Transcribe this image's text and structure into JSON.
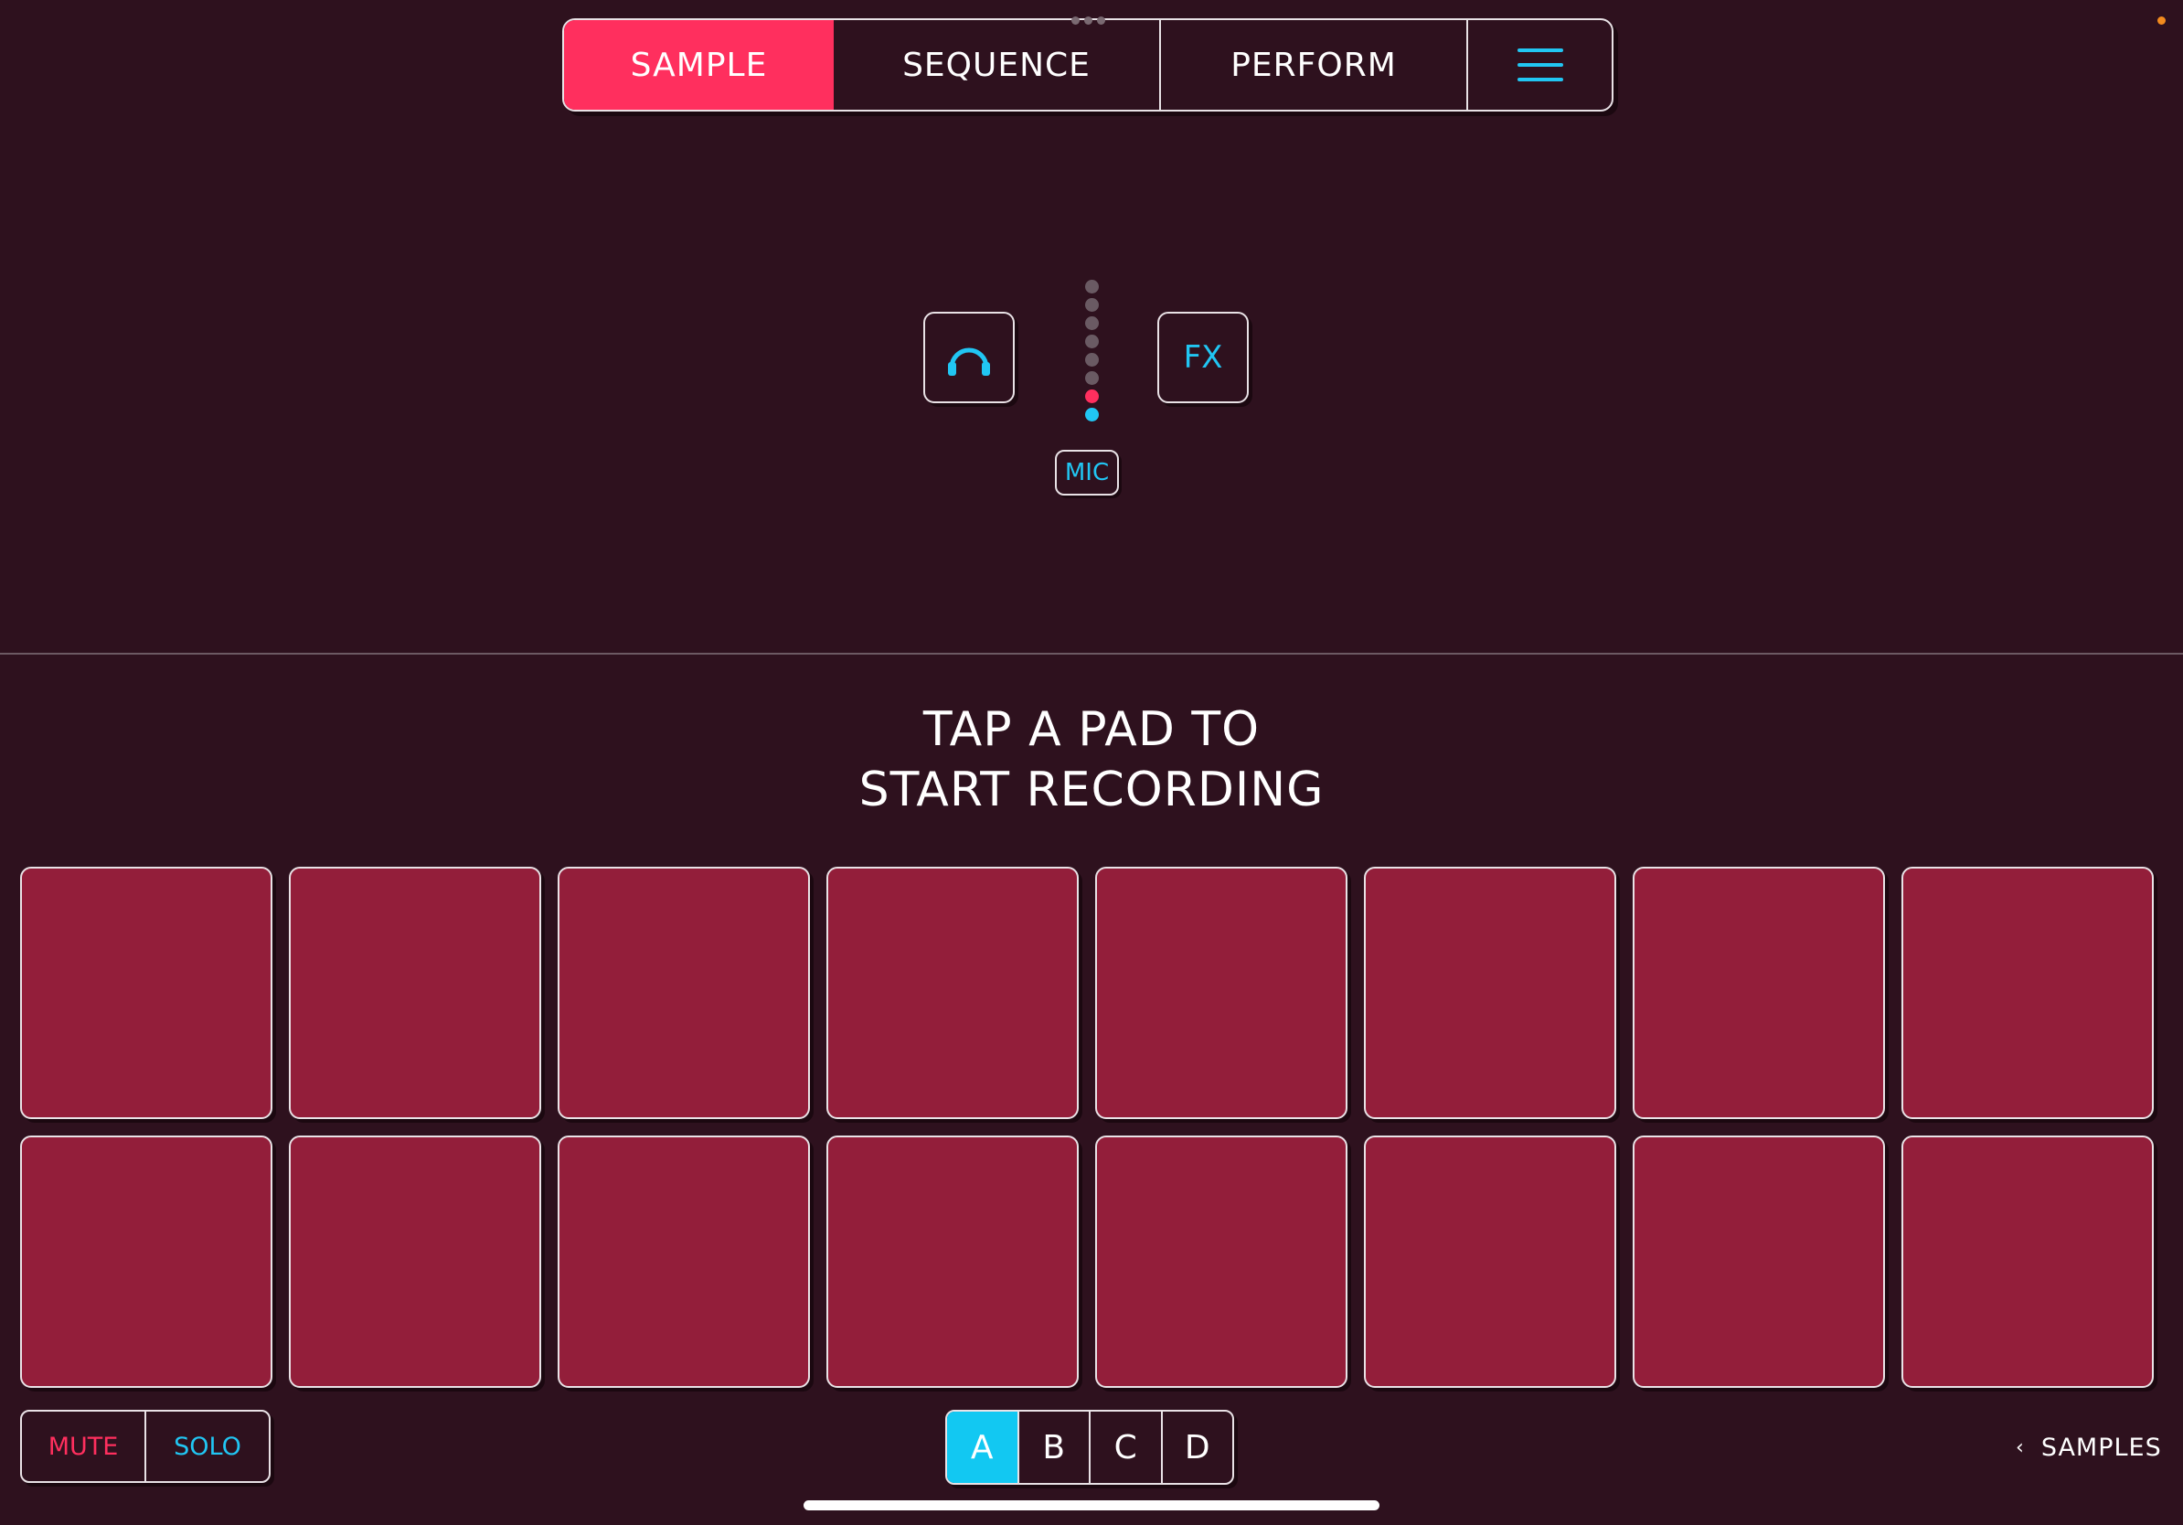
{
  "header": {
    "tabs": [
      {
        "label": "SAMPLE",
        "active": true
      },
      {
        "label": "SEQUENCE",
        "active": false
      },
      {
        "label": "PERFORM",
        "active": false
      }
    ],
    "menu_icon": "hamburger-menu-icon"
  },
  "input": {
    "monitor_icon": "headphones-icon",
    "fx_label": "FX",
    "source_label": "MIC",
    "level_meter": {
      "segments": 8,
      "lit_segments": 2
    }
  },
  "instruction": {
    "line1": "TAP A PAD TO",
    "line2": "START RECORDING"
  },
  "pads": {
    "count": 16,
    "columns": 8
  },
  "footer": {
    "mute_label": "MUTE",
    "solo_label": "SOLO",
    "banks": [
      {
        "label": "A",
        "active": true
      },
      {
        "label": "B",
        "active": false
      },
      {
        "label": "C",
        "active": false
      },
      {
        "label": "D",
        "active": false
      }
    ],
    "samples_label": "SAMPLES"
  },
  "colors": {
    "background": "#2e111e",
    "accent_pink": "#ff2f5e",
    "accent_cyan": "#21c6f3",
    "pad_color": "#931e3a",
    "status_orange": "#f28b1e"
  }
}
